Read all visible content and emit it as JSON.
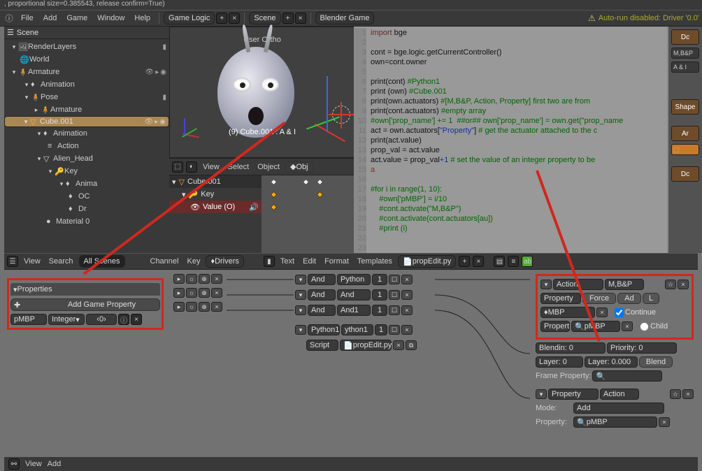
{
  "statusline": ", proportional size=0.385543, release confirm=True)",
  "menu": {
    "file": "File",
    "add": "Add",
    "game": "Game",
    "window": "Window",
    "help": "Help",
    "gamelogic": "Game Logic",
    "scene": "Scene",
    "engine": "Blender Game",
    "warn": "Auto-run disabled: Driver '0.0'"
  },
  "outliner": {
    "scene": "Scene",
    "render": "RenderLayers",
    "world": "World",
    "arm": "Armature",
    "anim": "Animation",
    "pose": "Pose",
    "arm2": "Armature",
    "cube": "Cube.001",
    "anim2": "Animation",
    "action": "Action",
    "alien": "Alien_Head",
    "key": "Key",
    "anima": "Anima",
    "oc": "OC",
    "dr": "Dr",
    "mat": "Material 0"
  },
  "viewport": {
    "ortho": "User Ortho",
    "name": "(9) Cube.001 : A & I",
    "view": "View",
    "select": "Select",
    "object": "Object",
    "obj_btn": "Obj"
  },
  "dopesheet": {
    "cube": "Cube.001",
    "key": "Key",
    "value": "Value (O)",
    "frame": "9"
  },
  "midbar": {
    "view": "View",
    "search": "Search",
    "allscenes": "All Scenes",
    "channel": "Channel",
    "key": "Key",
    "drivers": "Drivers",
    "text": "Text",
    "edit": "Edit",
    "format": "Format",
    "templates": "Templates",
    "file": "propEdit.py"
  },
  "code": [
    {
      "n": "1",
      "html": "<span class='c-kw'>import</span> bge"
    },
    {
      "n": "2",
      "html": ""
    },
    {
      "n": "3",
      "html": "cont = bge.logic.getCurrentController()"
    },
    {
      "n": "4",
      "html": "own=cont.owner"
    },
    {
      "n": "5",
      "html": ""
    },
    {
      "n": "6",
      "html": "print(cont) <span class='c-cm'>#Python1</span>"
    },
    {
      "n": "7",
      "html": "print (own) <span class='c-cm'>#Cube.001</span>"
    },
    {
      "n": "8",
      "html": "print(own.actuators) <span class='c-cm'>#[M,B&amp;P, Action, Property] first two are from </span>"
    },
    {
      "n": "9",
      "html": "print(cont.actuators) <span class='c-cm'>#empty array</span>"
    },
    {
      "n": "10",
      "html": "<span class='c-cm'>#own['prop_name'] += 1  ##or## own['prop_name'] = own.get(\"prop_name</span>"
    },
    {
      "n": "11",
      "html": "act = own.actuators[<span class='c-str'>\"Property\"</span>] <span class='c-cm'># get the actuator attached to the c</span>"
    },
    {
      "n": "12",
      "html": "print(act.value)"
    },
    {
      "n": "13",
      "html": "prop_val = act.value"
    },
    {
      "n": "14",
      "html": "act.value = prop_val<span class='c-num'>+1</span> <span class='c-cm'># set the value of an integer property to be</span>"
    },
    {
      "n": "15",
      "html": "<span class='c-red'>a</span>"
    },
    {
      "n": "16",
      "html": ""
    },
    {
      "n": "17",
      "html": "<span class='c-cm'>#for i in range(1, 10):</span>"
    },
    {
      "n": "18",
      "html": "<span class='c-cm'>    #own['pMBP'] = i/10</span>"
    },
    {
      "n": "19",
      "html": "<span class='c-cm'>    #cont.activate(\"M,B&amp;P\")</span>"
    },
    {
      "n": "20",
      "html": "<span class='c-cm'>    #cont.activate(cont.actuators[au])</span>"
    },
    {
      "n": "21",
      "html": "<span class='c-cm'>    #print (i)</span>"
    },
    {
      "n": "22",
      "html": ""
    },
    {
      "n": "23",
      "html": ""
    }
  ],
  "minipanel": {
    "do1": "Dc",
    "mbp": "M,B&P",
    "ai": "A & I",
    "shape": "Shape",
    "ar": "Ar"
  },
  "props": {
    "hdr": "Properties",
    "add": "Add Game Property",
    "name": "pMBP",
    "type": "Integer",
    "val": "0"
  },
  "controllers": {
    "and": "And",
    "python": "Python",
    "and1": "And1",
    "python1": "Python1",
    "ython1": "ython1",
    "script": "Script",
    "propedit": "propEdit.py",
    "one": "1"
  },
  "actuator": {
    "type": "Action",
    "name": "M,B&P",
    "property": "Property",
    "force": "Force",
    "add": "Ad",
    "L": "L",
    "mbp": "MBP",
    "continue": "Continue",
    "prop": "Propert",
    "pmbp": "pMBP",
    "child": "Child",
    "blendin": "Blendin: 0",
    "priority": "Priority: 0",
    "layer": "Layer: 0",
    "layerw": "Layer: 0.000",
    "blend": "Blend",
    "frameprop": "Frame Property:",
    "prop2_type": "Property",
    "prop2_name": "Action",
    "mode": "Mode:",
    "mode_val": "Add",
    "property_lbl": "Property:",
    "property_val": "pMBP"
  },
  "bottom": {
    "view": "View",
    "add": "Add"
  }
}
